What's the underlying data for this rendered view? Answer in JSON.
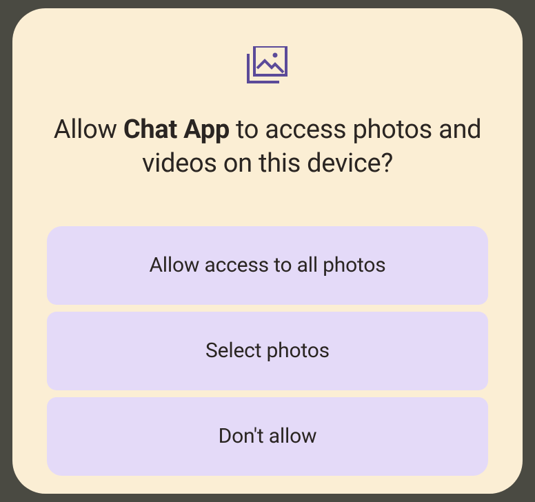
{
  "dialog": {
    "title_prefix": "Allow ",
    "app_name": "Chat App",
    "title_suffix": " to access photos and videos on this device?",
    "icon": "photo-gallery-icon",
    "options": [
      "Allow access to all photos",
      "Select photos",
      "Don't allow"
    ]
  }
}
